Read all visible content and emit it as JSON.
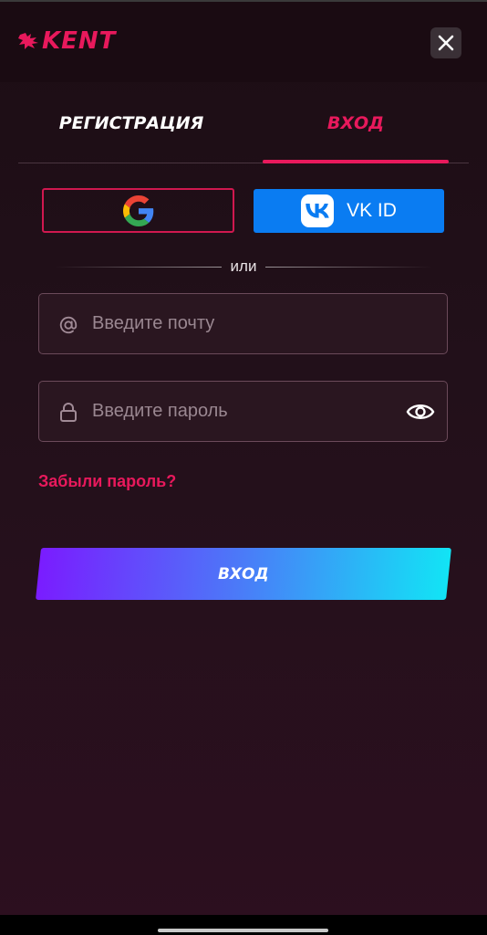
{
  "header": {
    "logo_text": "KENT",
    "close_icon": "close-icon"
  },
  "tabs": [
    {
      "label": "РЕГИСТРАЦИЯ",
      "active": false
    },
    {
      "label": "ВХОД",
      "active": true
    }
  ],
  "social": {
    "google_icon": "google-icon",
    "vk_label": "VK ID",
    "vk_icon": "vk-icon"
  },
  "divider_text": "или",
  "email_field": {
    "placeholder": "Введите почту",
    "value": "",
    "icon": "at-icon"
  },
  "password_field": {
    "placeholder": "Введите пароль",
    "value": "",
    "icon": "lock-icon",
    "toggle_icon": "eye-icon"
  },
  "forgot_password": "Забыли пароль?",
  "submit_label": "ВХОД",
  "colors": {
    "accent": "#e8195c",
    "vk_blue": "#0a7cf2",
    "gradient_start": "#7a1cff",
    "gradient_end": "#12e4f5"
  }
}
